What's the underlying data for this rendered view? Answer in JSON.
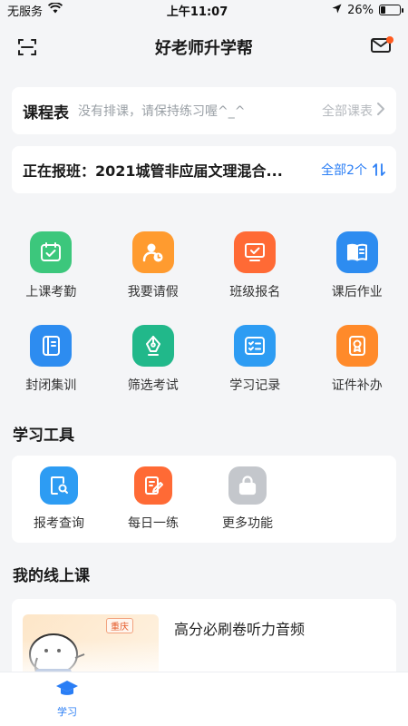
{
  "status_bar": {
    "carrier": "无服务",
    "time": "上午11:07",
    "battery": "26%",
    "battery_level": 0.26
  },
  "nav": {
    "title": "好老师升学帮"
  },
  "schedule": {
    "title": "课程表",
    "hint": "没有排课，请保持练习喔^_^",
    "all_label": "全部课表"
  },
  "enrollment": {
    "text": "正在报班：2021城管非应届文理混合...",
    "all_label": "全部2个"
  },
  "grid": [
    {
      "label": "上课考勤",
      "icon": "calendar-check-icon",
      "color": "#3cc77c"
    },
    {
      "label": "我要请假",
      "icon": "person-clock-icon",
      "color": "#ff9b2f"
    },
    {
      "label": "班级报名",
      "icon": "monitor-check-icon",
      "color": "#ff6a35"
    },
    {
      "label": "课后作业",
      "icon": "open-book-icon",
      "color": "#2d8cf0"
    },
    {
      "label": "封闭集训",
      "icon": "notebook-icon",
      "color": "#2d8cf0"
    },
    {
      "label": "筛选考试",
      "icon": "pen-nib-icon",
      "color": "#21b88a"
    },
    {
      "label": "学习记录",
      "icon": "list-check-icon",
      "color": "#2d9cf3"
    },
    {
      "label": "证件补办",
      "icon": "id-badge-icon",
      "color": "#ff8a2a"
    }
  ],
  "tools": {
    "title": "学习工具",
    "items": [
      {
        "label": "报考查询",
        "icon": "doc-search-icon",
        "color": "#2d9cf3"
      },
      {
        "label": "每日一练",
        "icon": "doc-edit-icon",
        "color": "#ff6a35"
      },
      {
        "label": "更多功能",
        "icon": "lock-icon",
        "color": "#c4c7cc"
      }
    ]
  },
  "online": {
    "title": "我的线上课",
    "course_title": "高分必刷卷听力音频",
    "thumb_tag": "重庆"
  },
  "tab_bar": {
    "study_label": "学习"
  }
}
